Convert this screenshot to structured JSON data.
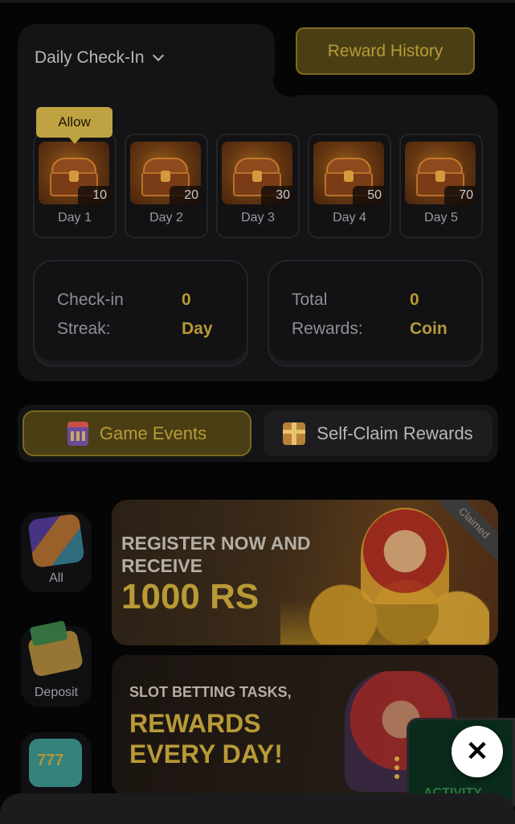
{
  "checkin": {
    "title": "Daily Check-In",
    "history_button": "Reward History",
    "allow_badge": "Allow",
    "days": [
      {
        "label": "Day 1",
        "amount": "10"
      },
      {
        "label": "Day 2",
        "amount": "20"
      },
      {
        "label": "Day 3",
        "amount": "30"
      },
      {
        "label": "Day 4",
        "amount": "50"
      },
      {
        "label": "Day 5",
        "amount": "70"
      }
    ],
    "streak": {
      "label_line1": "Check-in",
      "label_line2": "Streak:",
      "value": "0",
      "unit": "Day"
    },
    "total": {
      "label_line1": "Total",
      "label_line2": "Rewards:",
      "value": "0",
      "unit": "Coin"
    }
  },
  "tabs": {
    "game_events": "Game Events",
    "self_claim": "Self-Claim Rewards"
  },
  "categories": [
    {
      "label": "All"
    },
    {
      "label": "Deposit"
    }
  ],
  "banners": {
    "register": {
      "line1": "REGISTER NOW AND",
      "line2": "RECEIVE",
      "amount": "1000 RS",
      "ribbon": "Claimed"
    },
    "slot": {
      "line1": "SLOT BETTING TASKS,",
      "line2": "REWARDS",
      "line3": "EVERY DAY!"
    }
  },
  "activity": {
    "label": "ACTIVITY"
  },
  "close_symbol": "✕",
  "colors": {
    "accent_gold": "#b89a36",
    "panel": "#141416",
    "background": "#050505"
  }
}
